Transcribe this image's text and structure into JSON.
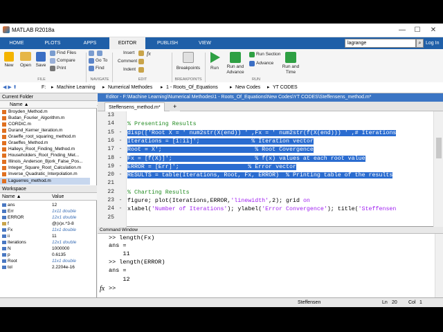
{
  "window": {
    "title": "MATLAB R2018a",
    "min": "—",
    "max": "☐",
    "close": "✕"
  },
  "tabs": [
    {
      "label": "HOME"
    },
    {
      "label": "PLOTS"
    },
    {
      "label": "APPS"
    },
    {
      "label": "EDITOR"
    },
    {
      "label": "PUBLISH"
    },
    {
      "label": "VIEW"
    }
  ],
  "search": {
    "value": "lagrange",
    "button": "⌕",
    "login": "Log In"
  },
  "ribbon": {
    "new": "New",
    "open": "Open",
    "save": "Save",
    "find_files": "Find Files",
    "compare": "Compare",
    "print": "Print",
    "goto": "Go To",
    "find": "Find",
    "insert": "Insert",
    "comment": "Comment",
    "indent": "Indent",
    "fx_btn": "fx",
    "breakpoints": "Breakpoints",
    "run": "Run",
    "run_advance": "Run and\nAdvance",
    "run_section": "Run Section",
    "advance": "Advance",
    "run_time": "Run and\nTime",
    "groups": [
      "FILE",
      "NAVIGATE",
      "EDIT",
      "BREAKPOINTS",
      "RUN"
    ]
  },
  "path": {
    "segments": [
      "F:",
      "Machine Learning",
      "Numerical Methodes",
      "1 - Roots_Of_Equations",
      "New Codes",
      "YT CODES"
    ]
  },
  "current_folder": {
    "title": "Current Folder",
    "column": "Name ▲",
    "files": [
      "Broyden_Method.m",
      "Budan_Fourier_Algorithm.m",
      "CORDIC.m",
      "Durand_Kerner_iteration.m",
      "Graeffe_root_squaring_method.m",
      "Graeffes_Method.m",
      "Halleys_Root_Finding_Method.m",
      "Householders_Root_Finding_Met...",
      "Illinois_Anderson_Bjork_False_Pos...",
      "Integer_Square_Root_Calculation.m",
      "Inverse_Quadratic_Interpolation.m",
      "Laguerres_method.m"
    ],
    "selected": "Laguerres_method.m"
  },
  "workspace": {
    "title": "Workspace",
    "col_name": "Name ▲",
    "col_value": "Value",
    "vars": [
      {
        "name": "ans",
        "value": "12",
        "italic": false
      },
      {
        "name": "Err",
        "value": "1x11 double",
        "italic": true
      },
      {
        "name": "ERROR",
        "value": "12x1 double",
        "italic": true
      },
      {
        "name": "f",
        "value": "@(x)x.^3-8",
        "italic": false
      },
      {
        "name": "Fx",
        "value": "11x1 double",
        "italic": true
      },
      {
        "name": "ii",
        "value": "11",
        "italic": false
      },
      {
        "name": "Iterations",
        "value": "12x1 double",
        "italic": true
      },
      {
        "name": "N",
        "value": "1000000",
        "italic": false
      },
      {
        "name": "p",
        "value": "0.6135",
        "italic": false
      },
      {
        "name": "Root",
        "value": "11x1 double",
        "italic": true
      },
      {
        "name": "tol",
        "value": "2.2204e-16",
        "italic": false
      }
    ]
  },
  "editor": {
    "header": "Editor - F:\\Machine Learning\\Numerical Methodes\\1 - Roots_Of_Equations\\New Codes\\YT CODES\\Steffensens_method.m*",
    "tab": "Steffensens_method.m*",
    "plus": "+",
    "lines": [
      {
        "n": "13",
        "dash": "",
        "segs": [
          {
            "t": "",
            "c": ""
          }
        ]
      },
      {
        "n": "14",
        "dash": "",
        "segs": [
          {
            "t": "% Presenting Results",
            "c": "cm"
          }
        ]
      },
      {
        "n": "15",
        "dash": "-",
        "segs": [
          {
            "t": "disp([",
            "c": "hl"
          },
          {
            "t": "'Root X = '",
            "c": "hl"
          },
          {
            "t": " num2str(X(end)) ",
            "c": "hl"
          },
          {
            "t": "' ,Fx = '",
            "c": "hl"
          },
          {
            "t": " num2str(f(X(end))) ",
            "c": "hl"
          },
          {
            "t": "' ,# Iterations",
            "c": "hl"
          }
        ]
      },
      {
        "n": "16",
        "dash": "-",
        "segs": [
          {
            "t": "Iterations = [1:ii]';               % Iteration vector",
            "c": "hl"
          }
        ]
      },
      {
        "n": "17",
        "dash": "-",
        "segs": [
          {
            "t": "Root = X';                           % Root Covergence",
            "c": "hl"
          }
        ]
      },
      {
        "n": "18",
        "dash": "-",
        "segs": [
          {
            "t": "Fx = [f(X)]';                        % f(x) values at each root value",
            "c": "hl"
          }
        ]
      },
      {
        "n": "19",
        "dash": "-",
        "segs": [
          {
            "t": "ERROR = [Err]';                    % Error vector",
            "c": "hl"
          }
        ]
      },
      {
        "n": "20",
        "dash": "-",
        "segs": [
          {
            "t": "RESULTS = table(Iterations, Root, Fx, ERROR)  % Printing table of the results",
            "c": "hl"
          }
        ]
      },
      {
        "n": "21",
        "dash": "",
        "segs": [
          {
            "t": "",
            "c": ""
          }
        ]
      },
      {
        "n": "22",
        "dash": "",
        "segs": [
          {
            "t": "% Charting Results",
            "c": "cm"
          }
        ]
      },
      {
        "n": "23",
        "dash": "-",
        "segs": [
          {
            "t": "figure; plot(Iterations,ERROR,",
            "c": ""
          },
          {
            "t": "'linewidth'",
            "c": "st"
          },
          {
            "t": ",2); grid ",
            "c": ""
          },
          {
            "t": "on",
            "c": "st"
          }
        ]
      },
      {
        "n": "24",
        "dash": "-",
        "segs": [
          {
            "t": "xlabel(",
            "c": ""
          },
          {
            "t": "'Number of Iterations'",
            "c": "st"
          },
          {
            "t": "); ylabel(",
            "c": ""
          },
          {
            "t": "'Error Convergence'",
            "c": "st"
          },
          {
            "t": "); title(",
            "c": ""
          },
          {
            "t": "'Steffensen",
            "c": "st"
          }
        ]
      },
      {
        "n": "25",
        "dash": "",
        "segs": [
          {
            "t": "",
            "c": ""
          }
        ]
      }
    ]
  },
  "command_window": {
    "title": "Command Window",
    "lines": [
      ">> length(Fx)",
      "ans =",
      "",
      "    11",
      "",
      ">> length(ERROR)",
      "ans =",
      "",
      "    12"
    ],
    "prompt": ">>",
    "fx": "fx"
  },
  "status": {
    "function": "Steffensen",
    "ln_label": "Ln",
    "ln": "20",
    "col_label": "Col",
    "col": "1"
  }
}
